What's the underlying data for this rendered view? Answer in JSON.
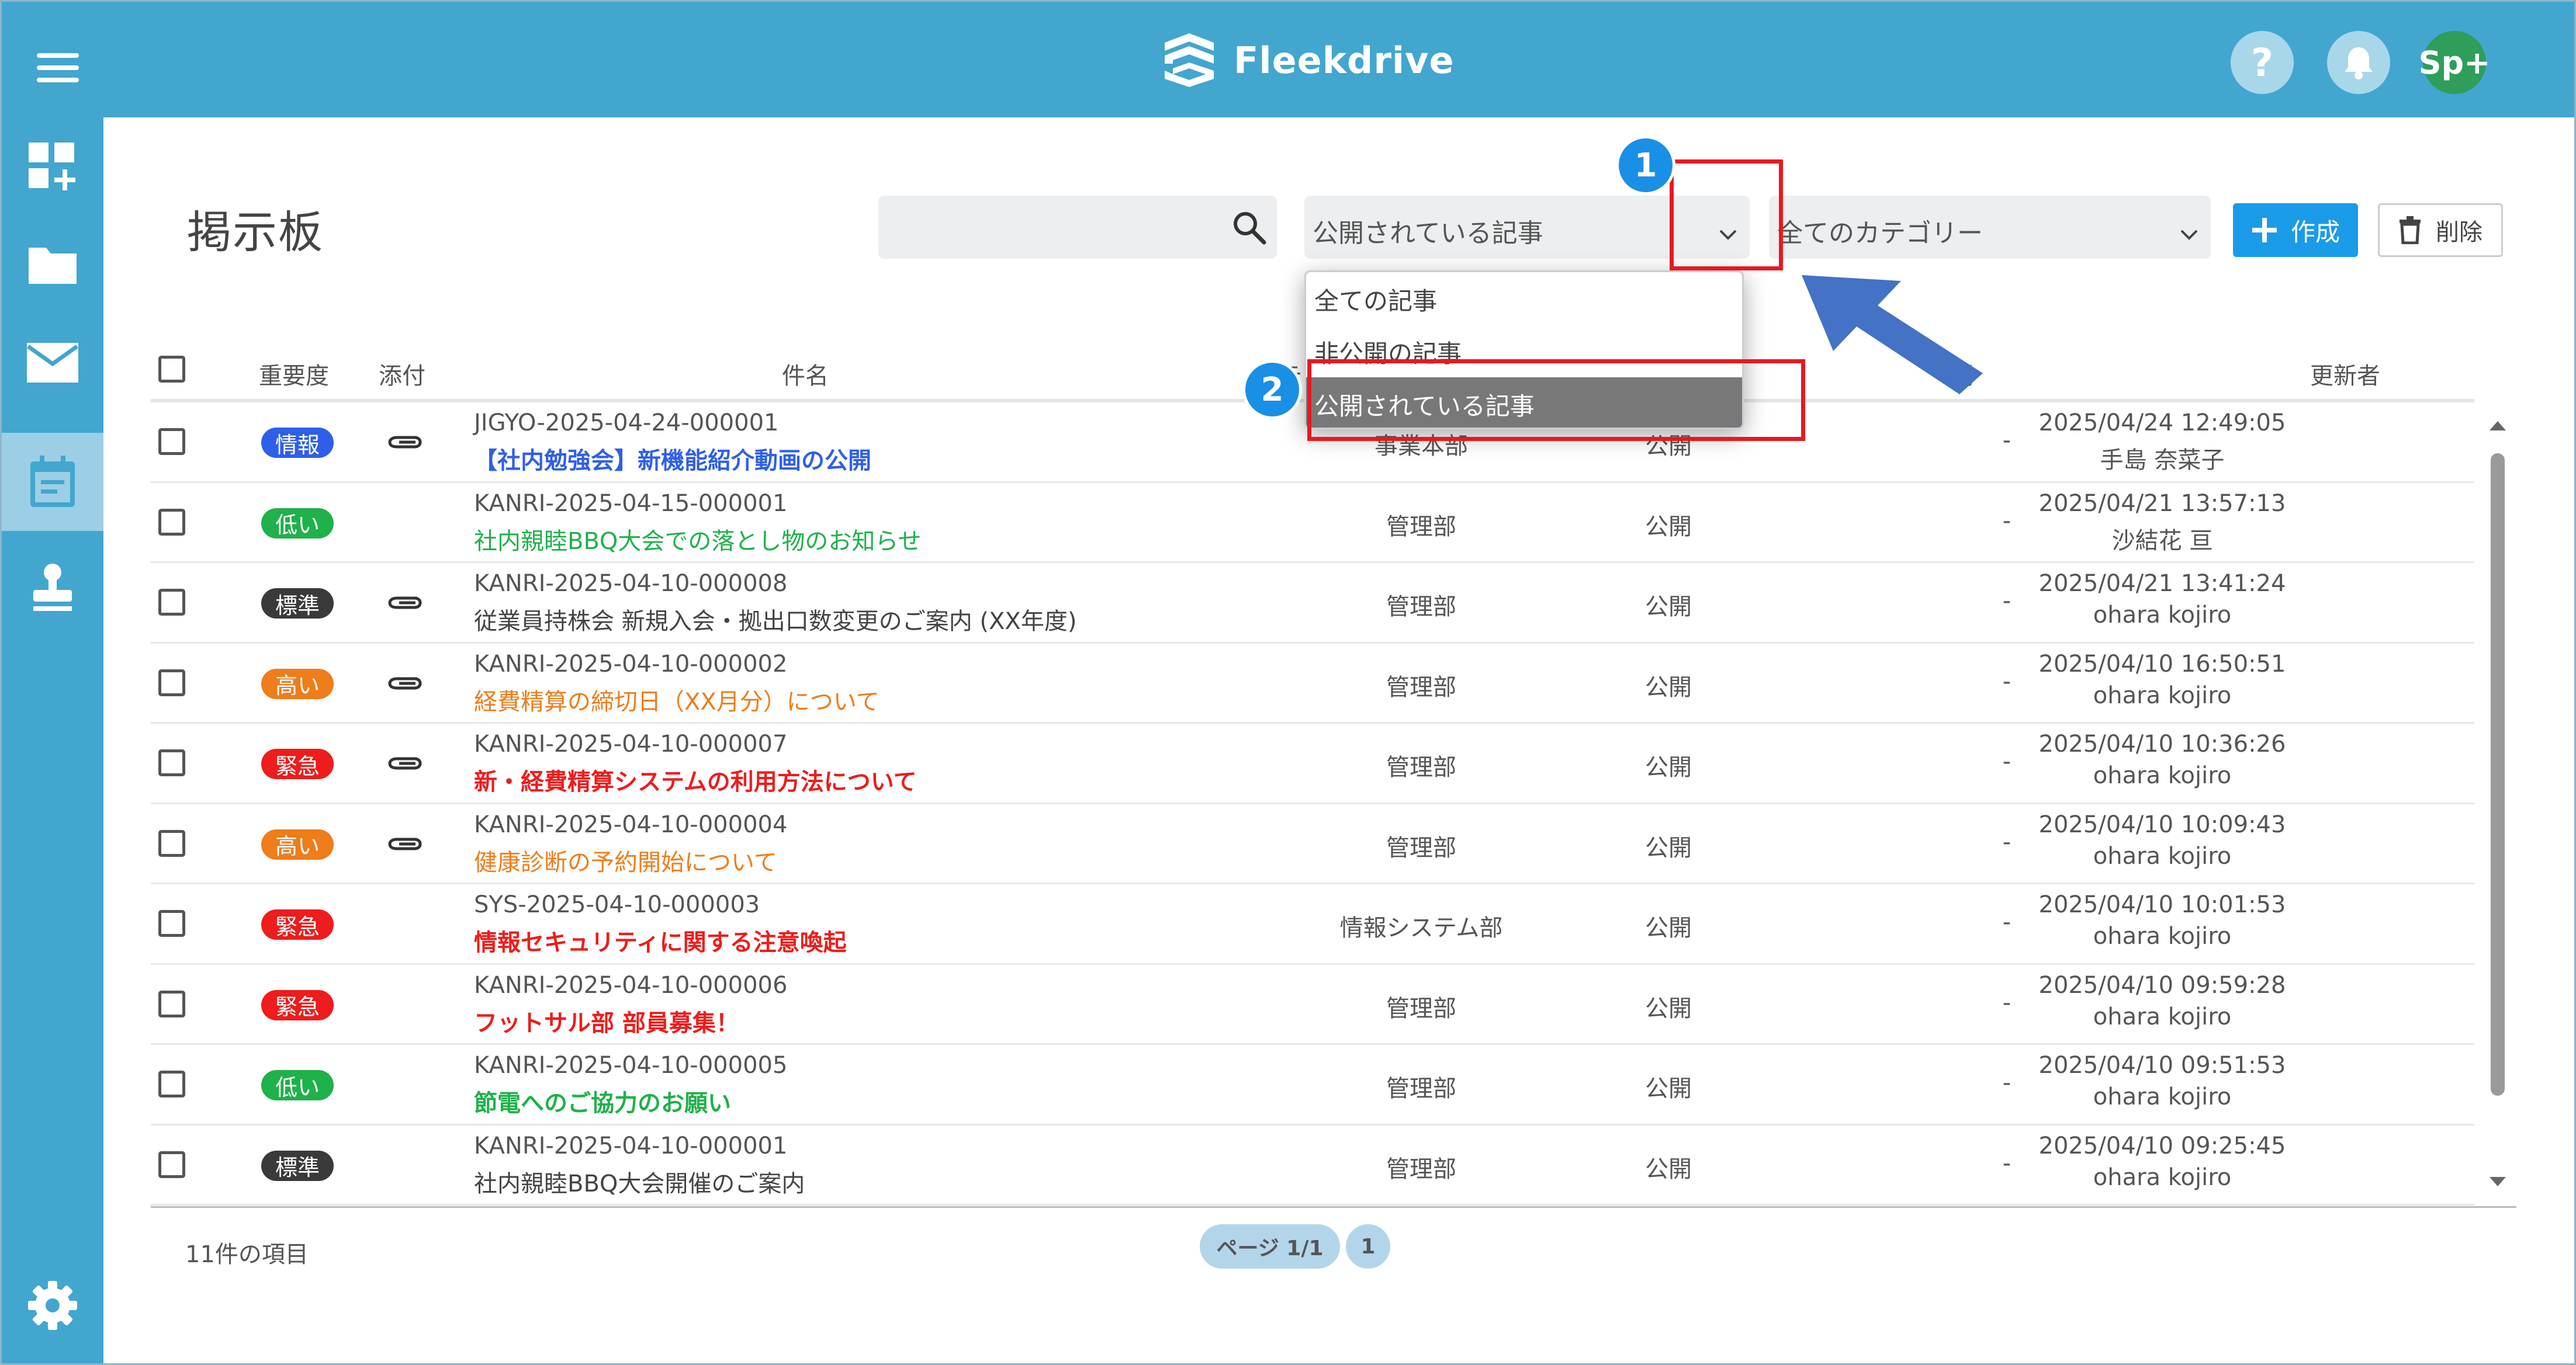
{
  "app": {
    "name": "Fleekdrive",
    "user_initials": "Sp+",
    "help_glyph": "?"
  },
  "page": {
    "title": "掲示板"
  },
  "search": {
    "placeholder": ""
  },
  "filters": {
    "status_selected": "公開されている記事",
    "category_selected": "全てのカテゴリー",
    "status_options": [
      "全ての記事",
      "非公開の記事",
      "公開されている記事"
    ]
  },
  "toolbar": {
    "create_label": "作成",
    "delete_label": "削除"
  },
  "table": {
    "headers": {
      "importance": "重要度",
      "attachment": "添付",
      "subject": "件名",
      "category": "カテ",
      "period": "掲",
      "updater": "更新者"
    },
    "rows": [
      {
        "badge": "情報",
        "badge_color": "#2f5fe8",
        "attach": true,
        "code": "JIGYO-2025-04-24-000001",
        "subject": "【社内勉強会】新機能紹介動画の公開",
        "subject_color": "#2f5fe8",
        "subject_bold": true,
        "dept": "事業本部",
        "status": "公開",
        "period": "-",
        "date": "2025/04/24 12:49:05",
        "updater": "手島 奈菜子"
      },
      {
        "badge": "低い",
        "badge_color": "#1fb14a",
        "attach": false,
        "code": "KANRI-2025-04-15-000001",
        "subject": "社内親睦BBQ大会での落とし物のお知らせ",
        "subject_color": "#1fb14a",
        "subject_bold": false,
        "dept": "管理部",
        "status": "公開",
        "period": "-",
        "date": "2025/04/21 13:57:13",
        "updater": "沙結花 亘"
      },
      {
        "badge": "標準",
        "badge_color": "#3a3a3a",
        "attach": true,
        "code": "KANRI-2025-04-10-000008",
        "subject": "従業員持株会 新規入会・拠出口数変更のご案内 (XX年度)",
        "subject_color": "#444444",
        "subject_bold": false,
        "dept": "管理部",
        "status": "公開",
        "period": "-",
        "date": "2025/04/21 13:41:24",
        "updater": "ohara kojiro"
      },
      {
        "badge": "高い",
        "badge_color": "#ee7d1a",
        "attach": true,
        "code": "KANRI-2025-04-10-000002",
        "subject": "経費精算の締切日（XX月分）について",
        "subject_color": "#ee7d1a",
        "subject_bold": false,
        "dept": "管理部",
        "status": "公開",
        "period": "-",
        "date": "2025/04/10 16:50:51",
        "updater": "ohara kojiro"
      },
      {
        "badge": "緊急",
        "badge_color": "#ee1c1c",
        "attach": true,
        "code": "KANRI-2025-04-10-000007",
        "subject": "新・経費精算システムの利用方法について",
        "subject_color": "#ee1c1c",
        "subject_bold": true,
        "dept": "管理部",
        "status": "公開",
        "period": "-",
        "date": "2025/04/10 10:36:26",
        "updater": "ohara kojiro"
      },
      {
        "badge": "高い",
        "badge_color": "#ee7d1a",
        "attach": true,
        "code": "KANRI-2025-04-10-000004",
        "subject": "健康診断の予約開始について",
        "subject_color": "#ee7d1a",
        "subject_bold": false,
        "dept": "管理部",
        "status": "公開",
        "period": "-",
        "date": "2025/04/10 10:09:43",
        "updater": "ohara kojiro"
      },
      {
        "badge": "緊急",
        "badge_color": "#ee1c1c",
        "attach": false,
        "code": "SYS-2025-04-10-000003",
        "subject": "情報セキュリティに関する注意喚起",
        "subject_color": "#ee1c1c",
        "subject_bold": true,
        "dept": "情報システム部",
        "status": "公開",
        "period": "-",
        "date": "2025/04/10 10:01:53",
        "updater": "ohara kojiro"
      },
      {
        "badge": "緊急",
        "badge_color": "#ee1c1c",
        "attach": false,
        "code": "KANRI-2025-04-10-000006",
        "subject": "フットサル部 部員募集！",
        "subject_color": "#ee1c1c",
        "subject_bold": true,
        "dept": "管理部",
        "status": "公開",
        "period": "-",
        "date": "2025/04/10 09:59:28",
        "updater": "ohara kojiro"
      },
      {
        "badge": "低い",
        "badge_color": "#1fb14a",
        "attach": false,
        "code": "KANRI-2025-04-10-000005",
        "subject": "節電へのご協力のお願い",
        "subject_color": "#1fb14a",
        "subject_bold": true,
        "dept": "管理部",
        "status": "公開",
        "period": "-",
        "date": "2025/04/10 09:51:53",
        "updater": "ohara kojiro"
      },
      {
        "badge": "標準",
        "badge_color": "#3a3a3a",
        "attach": false,
        "code": "KANRI-2025-04-10-000001",
        "subject": "社内親睦BBQ大会開催のご案内",
        "subject_color": "#444444",
        "subject_bold": false,
        "dept": "管理部",
        "status": "公開",
        "period": "-",
        "date": "2025/04/10 09:25:45",
        "updater": "ohara kojiro"
      }
    ]
  },
  "footer": {
    "item_count": "11件の項目",
    "page_label": "ページ 1/1",
    "page_number": "1"
  },
  "annotations": {
    "step1": "1",
    "step2": "2",
    "highlight_color": "#e8191f",
    "step_color": "#1a8fe6",
    "arrow_color": "#4472c4"
  },
  "colors": {
    "header_bg": "#42a6cf",
    "primary_button": "#1a9be8"
  }
}
